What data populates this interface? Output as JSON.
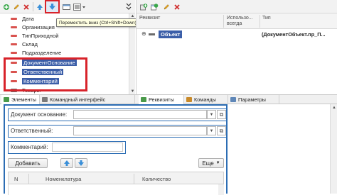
{
  "left_toolbar": {
    "icons": [
      "add-icon",
      "edit-icon",
      "delete-icon",
      "move-up-icon",
      "move-down-icon",
      "window-icon",
      "menu-icon",
      "chevron-down-icon"
    ]
  },
  "tooltip": {
    "text": "Переместить вниз (Ctrl+Shift+Down)"
  },
  "tree": {
    "items": [
      {
        "label": "Дата",
        "selected": false
      },
      {
        "label": "Организация",
        "selected": false
      },
      {
        "label": "ТипПриходной",
        "selected": false
      },
      {
        "label": "Склад",
        "selected": false
      },
      {
        "label": "Подразделение",
        "selected": false
      },
      {
        "label": "ДокументОснование",
        "selected": true
      },
      {
        "label": "Ответственный",
        "selected": true
      },
      {
        "label": "Комментарий",
        "selected": true
      },
      {
        "label": "Товары",
        "selected": false
      }
    ]
  },
  "right_pane": {
    "columns": {
      "attribute": "Реквизит",
      "used_line1": "Использо...",
      "used_line2": "всегда",
      "type": "Тип"
    },
    "row": {
      "name": "Объект",
      "type": "(ДокументОбъект.пр_П..."
    }
  },
  "tabs": {
    "elements": "Элементы",
    "command_interface": "Командный интерфейс",
    "attributes": "Реквизиты",
    "commands": "Команды",
    "parameters": "Параметры"
  },
  "form": {
    "doc_basis_label": "Документ основание:",
    "responsible_label": "Ответственный:",
    "comment_label": "Комментарий:",
    "add_button": "Добавить",
    "more_button": "Еще",
    "table_columns": {
      "n": "N",
      "nomenclature": "Номенклатура",
      "quantity": "Количество"
    }
  },
  "colors": {
    "highlight_red": "#d8232a",
    "selection_blue": "#3b5ea8",
    "form_border_blue": "#2c6db4",
    "tooltip_bg": "#ffffe1"
  }
}
